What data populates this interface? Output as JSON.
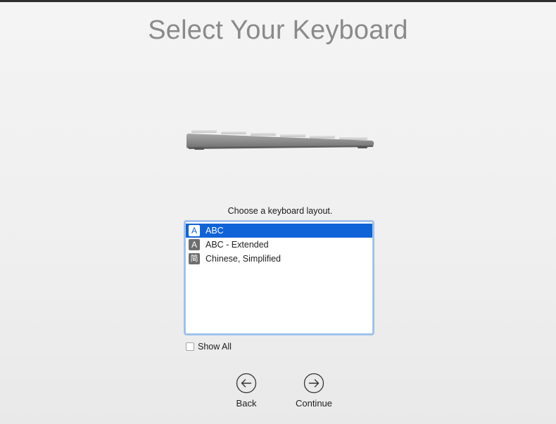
{
  "title": "Select Your Keyboard",
  "prompt": "Choose a keyboard layout.",
  "layouts": [
    {
      "label": "ABC",
      "icon_glyph": "A",
      "icon": "letter-a-icon",
      "selected": true
    },
    {
      "label": "ABC - Extended",
      "icon_glyph": "A",
      "icon": "letter-a-icon",
      "selected": false
    },
    {
      "label": "Chinese, Simplified",
      "icon_glyph": "简",
      "icon": "chinese-simplified-icon",
      "selected": false
    }
  ],
  "show_all": {
    "label": "Show All",
    "checked": false
  },
  "buttons": {
    "back": {
      "label": "Back",
      "icon": "arrow-left-icon"
    },
    "continue": {
      "label": "Continue",
      "icon": "arrow-right-icon"
    }
  },
  "colors": {
    "selection": "#0f63d6",
    "title": "#8a8a8a",
    "list_focus_ring": "#9dc0ee"
  }
}
